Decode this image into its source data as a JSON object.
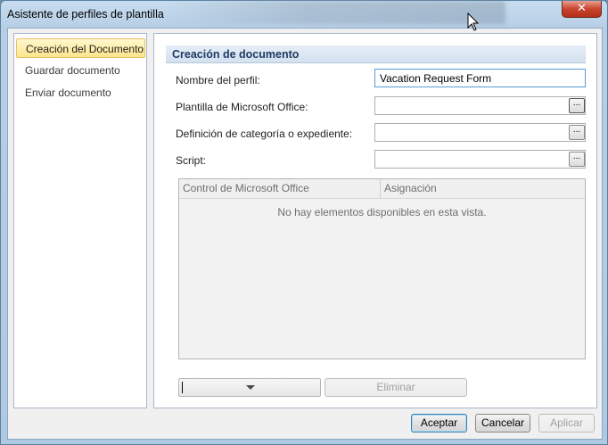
{
  "window": {
    "title": "Asistente de perfiles de plantilla",
    "close_label": "✕"
  },
  "nav": {
    "items": [
      {
        "label": "Creación del Documento",
        "active": true
      },
      {
        "label": "Guardar documento",
        "active": false
      },
      {
        "label": "Enviar documento",
        "active": false
      }
    ]
  },
  "section": {
    "title": "Creación de documento"
  },
  "fields": {
    "profile_name": {
      "label": "Nombre del perfil:",
      "value": "Vacation Request Form"
    },
    "office_template": {
      "label": "Plantilla de Microsoft Office:",
      "value": ""
    },
    "category": {
      "label": "Definición de categoría o expediente:",
      "value": ""
    },
    "script": {
      "label": "Script:",
      "value": ""
    },
    "browse_label": "..."
  },
  "grid": {
    "columns": [
      "Control de Microsoft Office",
      "Asignación"
    ],
    "empty_message": "No hay elementos disponibles en esta vista."
  },
  "actions": {
    "remove_label": "Eliminar"
  },
  "footer": {
    "accept_label": "Aceptar",
    "cancel_label": "Cancelar",
    "apply_label": "Aplicar"
  }
}
